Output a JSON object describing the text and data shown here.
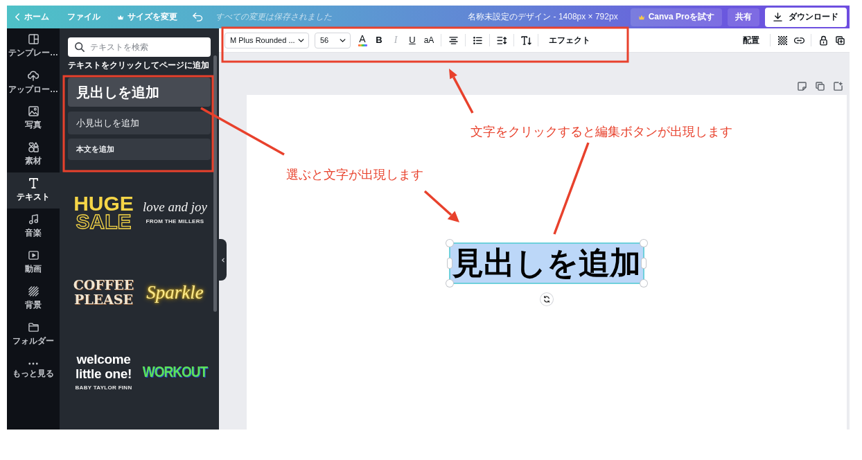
{
  "top_bar": {
    "home": "ホーム",
    "file": "ファイル",
    "resize": "サイズを変更",
    "save_status": "すべての変更は保存されました",
    "design_title": "名称未設定のデザイン - 1408px × 792px",
    "pro_button": "Canva Proを試す",
    "share": "共有",
    "download": "ダウンロード"
  },
  "side_rail": {
    "items": [
      {
        "label": "テンプレー…",
        "selected": false
      },
      {
        "label": "アップロー…",
        "selected": false
      },
      {
        "label": "写真",
        "selected": false
      },
      {
        "label": "素材",
        "selected": false
      },
      {
        "label": "テキスト",
        "selected": true
      },
      {
        "label": "音楽",
        "selected": false
      },
      {
        "label": "動画",
        "selected": false
      },
      {
        "label": "背景",
        "selected": false
      },
      {
        "label": "フォルダー",
        "selected": false
      },
      {
        "label": "もっと見る",
        "selected": false
      }
    ]
  },
  "text_panel": {
    "search": {
      "placeholder": "テキストを検索"
    },
    "heading": "テキストをクリックしてページに追加",
    "add_buttons": [
      {
        "kind": "heading",
        "label": "見出しを追加"
      },
      {
        "kind": "subheading",
        "label": "小見出しを追加"
      },
      {
        "kind": "body",
        "label": "本文を追加"
      }
    ],
    "samples": [
      {
        "kind": "block",
        "lines": [
          "HUGE",
          "SALE"
        ]
      },
      {
        "kind": "script",
        "lines": [
          "love and joy"
        ],
        "caption": "FROM THE MILLERS"
      },
      {
        "kind": "slab",
        "lines": [
          "COFFEE",
          "PLEASE"
        ]
      },
      {
        "kind": "neon",
        "lines": [
          "Sparkle"
        ]
      },
      {
        "kind": "rounded",
        "lines": [
          "welcome",
          "little one!"
        ],
        "caption": "BABY TAYLOR FINN"
      },
      {
        "kind": "condensed",
        "lines": [
          "WORKOUT"
        ]
      }
    ]
  },
  "toolbar": {
    "font": "M Plus Rounded ...",
    "size": "56",
    "format_buttons": [
      {
        "kind": "color",
        "label": "A",
        "disabled": false
      },
      {
        "kind": "bold",
        "label": "B",
        "disabled": false
      },
      {
        "kind": "italic",
        "label": "I",
        "disabled": true
      },
      {
        "kind": "underline",
        "label": "U",
        "disabled": false
      },
      {
        "kind": "case",
        "label": "aA",
        "disabled": false
      }
    ],
    "effects": "エフェクト",
    "position": "配置"
  },
  "page": {
    "elements": [
      {
        "text": "見出しを追加",
        "selected": true
      }
    ]
  },
  "annotations": {
    "callouts": [
      "文字をクリックすると編集ボタンが出現します",
      "選ぶと文字が出現します"
    ]
  }
}
